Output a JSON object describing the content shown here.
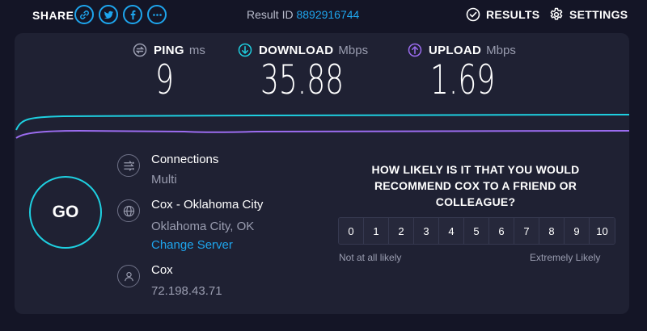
{
  "topbar": {
    "share_label": "SHARE",
    "share_icons": [
      "link-icon",
      "twitter-icon",
      "facebook-icon",
      "more-icon"
    ],
    "result_id_label": "Result ID",
    "result_id_value": "8892916744",
    "results_label": "RESULTS",
    "settings_label": "SETTINGS"
  },
  "metrics": {
    "ping": {
      "label": "PING",
      "unit": "ms",
      "value": "9",
      "color": "#9a9db0"
    },
    "download": {
      "label": "DOWNLOAD",
      "unit": "Mbps",
      "value": "35.88",
      "color": "#1ecfe0"
    },
    "upload": {
      "label": "UPLOAD",
      "unit": "Mbps",
      "value": "1.69",
      "color": "#9b6cf0"
    }
  },
  "go_button": {
    "label": "GO"
  },
  "connections": {
    "title": "Connections",
    "value": "Multi"
  },
  "server": {
    "title": "Cox - Oklahoma City",
    "location": "Oklahoma City, OK",
    "change_label": "Change Server"
  },
  "provider": {
    "name": "Cox",
    "ip": "72.198.43.71"
  },
  "survey": {
    "question": "HOW LIKELY IS IT THAT YOU WOULD RECOMMEND COX TO A FRIEND OR COLLEAGUE?",
    "scale": [
      "0",
      "1",
      "2",
      "3",
      "4",
      "5",
      "6",
      "7",
      "8",
      "9",
      "10"
    ],
    "low_label": "Not at all likely",
    "high_label": "Extremely Likely"
  },
  "colors": {
    "accent": "#1ea5ed",
    "download_line": "#1ecfe0",
    "upload_line": "#9b6cf0",
    "background": "#141526",
    "panel": "#1f2133"
  }
}
